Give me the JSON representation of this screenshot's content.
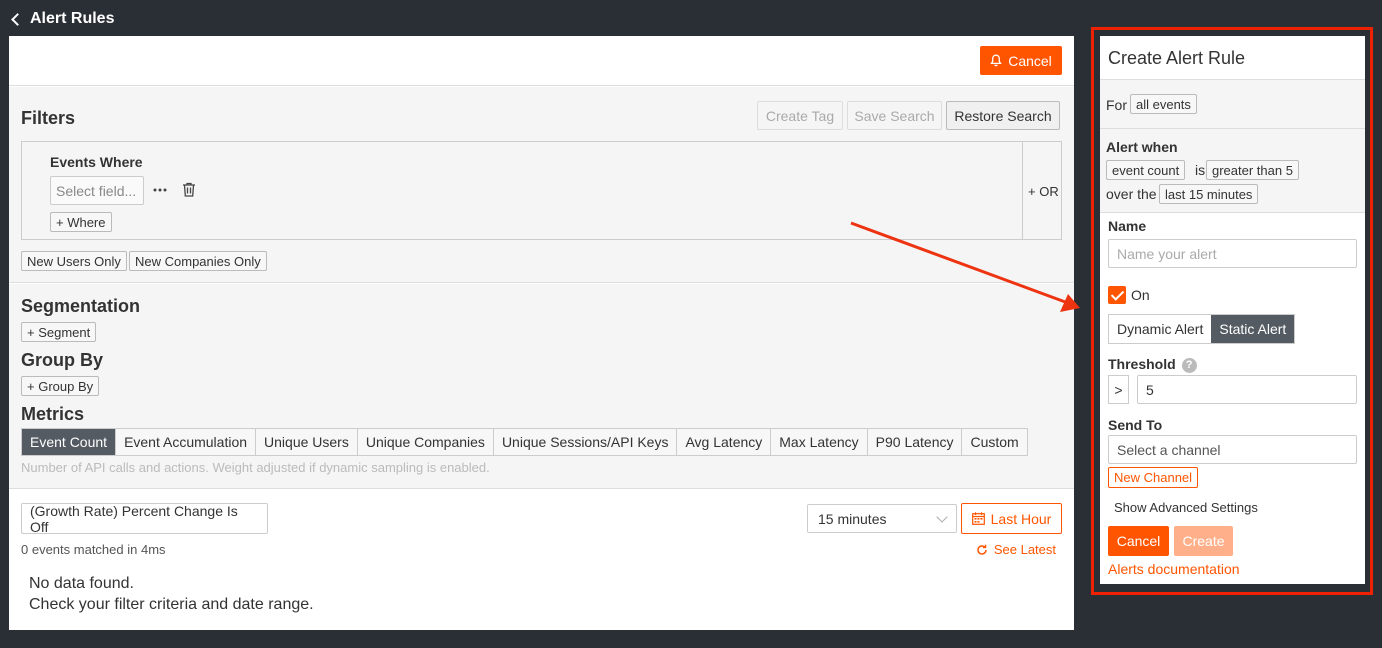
{
  "header": {
    "back_label": "Alert Rules"
  },
  "main": {
    "cancel_label": "Cancel",
    "filters": {
      "title": "Filters",
      "create_tag": "Create Tag",
      "save_search": "Save Search",
      "restore_search": "Restore Search",
      "events_where": "Events Where",
      "select_field_placeholder": "Select field...",
      "add_where": "+ Where",
      "or_label": "+ OR",
      "new_users_only": "New Users Only",
      "new_companies_only": "New Companies Only"
    },
    "segmentation": {
      "title": "Segmentation",
      "add": "+ Segment"
    },
    "group_by": {
      "title": "Group By",
      "add": "+ Group By"
    },
    "metrics": {
      "title": "Metrics",
      "tabs": [
        "Event Count",
        "Event Accumulation",
        "Unique Users",
        "Unique Companies",
        "Unique Sessions/API Keys",
        "Avg Latency",
        "Max Latency",
        "P90 Latency",
        "Custom"
      ],
      "active_index": 0,
      "hint": "Number of API calls and actions. Weight adjusted if dynamic sampling is enabled."
    },
    "results": {
      "growth_rate": "(Growth Rate) Percent Change Is Off",
      "interval": "15 minutes",
      "last_hour": "Last Hour",
      "matched": "0 events matched in 4ms",
      "see_latest": "See Latest",
      "no_data_line1": "No data found.",
      "no_data_line2": "Check your filter criteria and date range."
    }
  },
  "panel": {
    "title": "Create Alert Rule",
    "for_label": "For",
    "for_value": "all events",
    "alert_when": "Alert when",
    "metric": "event count",
    "is_label": "is",
    "condition": "greater than 5",
    "over_the": "over the",
    "period": "last 15 minutes",
    "name_label": "Name",
    "name_placeholder": "Name your alert",
    "on_label": "On",
    "dynamic_alert": "Dynamic Alert",
    "static_alert": "Static Alert",
    "threshold_label": "Threshold",
    "threshold_op": ">",
    "threshold_value": "5",
    "send_to_label": "Send To",
    "channel_placeholder": "Select a channel",
    "new_channel": "New Channel",
    "advanced": "Show Advanced Settings",
    "cancel": "Cancel",
    "create": "Create",
    "docs": "Alerts documentation"
  },
  "colors": {
    "accent": "#ff5500",
    "highlight_border": "#ee2200",
    "dark": "#2a2f35",
    "active_tab": "#555b63"
  }
}
